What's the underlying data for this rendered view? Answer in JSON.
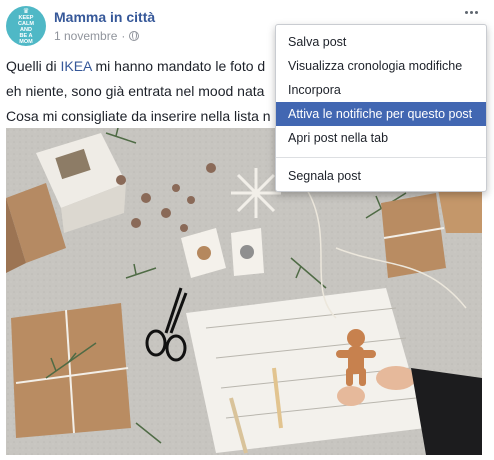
{
  "post": {
    "page_name": "Mamma in città",
    "date": "1 novembre",
    "avatar_text": [
      "KEEP",
      "CALM",
      "AND",
      "BE A",
      "MOM"
    ],
    "text_line1_before": "Quelli di ",
    "text_line1_link": "IKEA",
    "text_line1_after": " mi hanno mandato le foto d",
    "text_line2": "eh niente, sono già entrata nel mood nata",
    "text_line3": "Cosa mi consigliate da inserire nella lista n"
  },
  "menu": {
    "items": [
      {
        "label": "Salva post"
      },
      {
        "label": "Visualizza cronologia modifiche"
      },
      {
        "label": "Incorpora"
      },
      {
        "label": "Attiva le notifiche per questo post"
      },
      {
        "label": "Apri post nella tab"
      }
    ],
    "report": "Segnala post"
  },
  "colors": {
    "link": "#365899",
    "menu_highlight": "#4267b2",
    "avatar": "#4fb8c6",
    "secondary_text": "#90949c"
  },
  "icons": [
    "globe-icon",
    "more-options-icon"
  ]
}
